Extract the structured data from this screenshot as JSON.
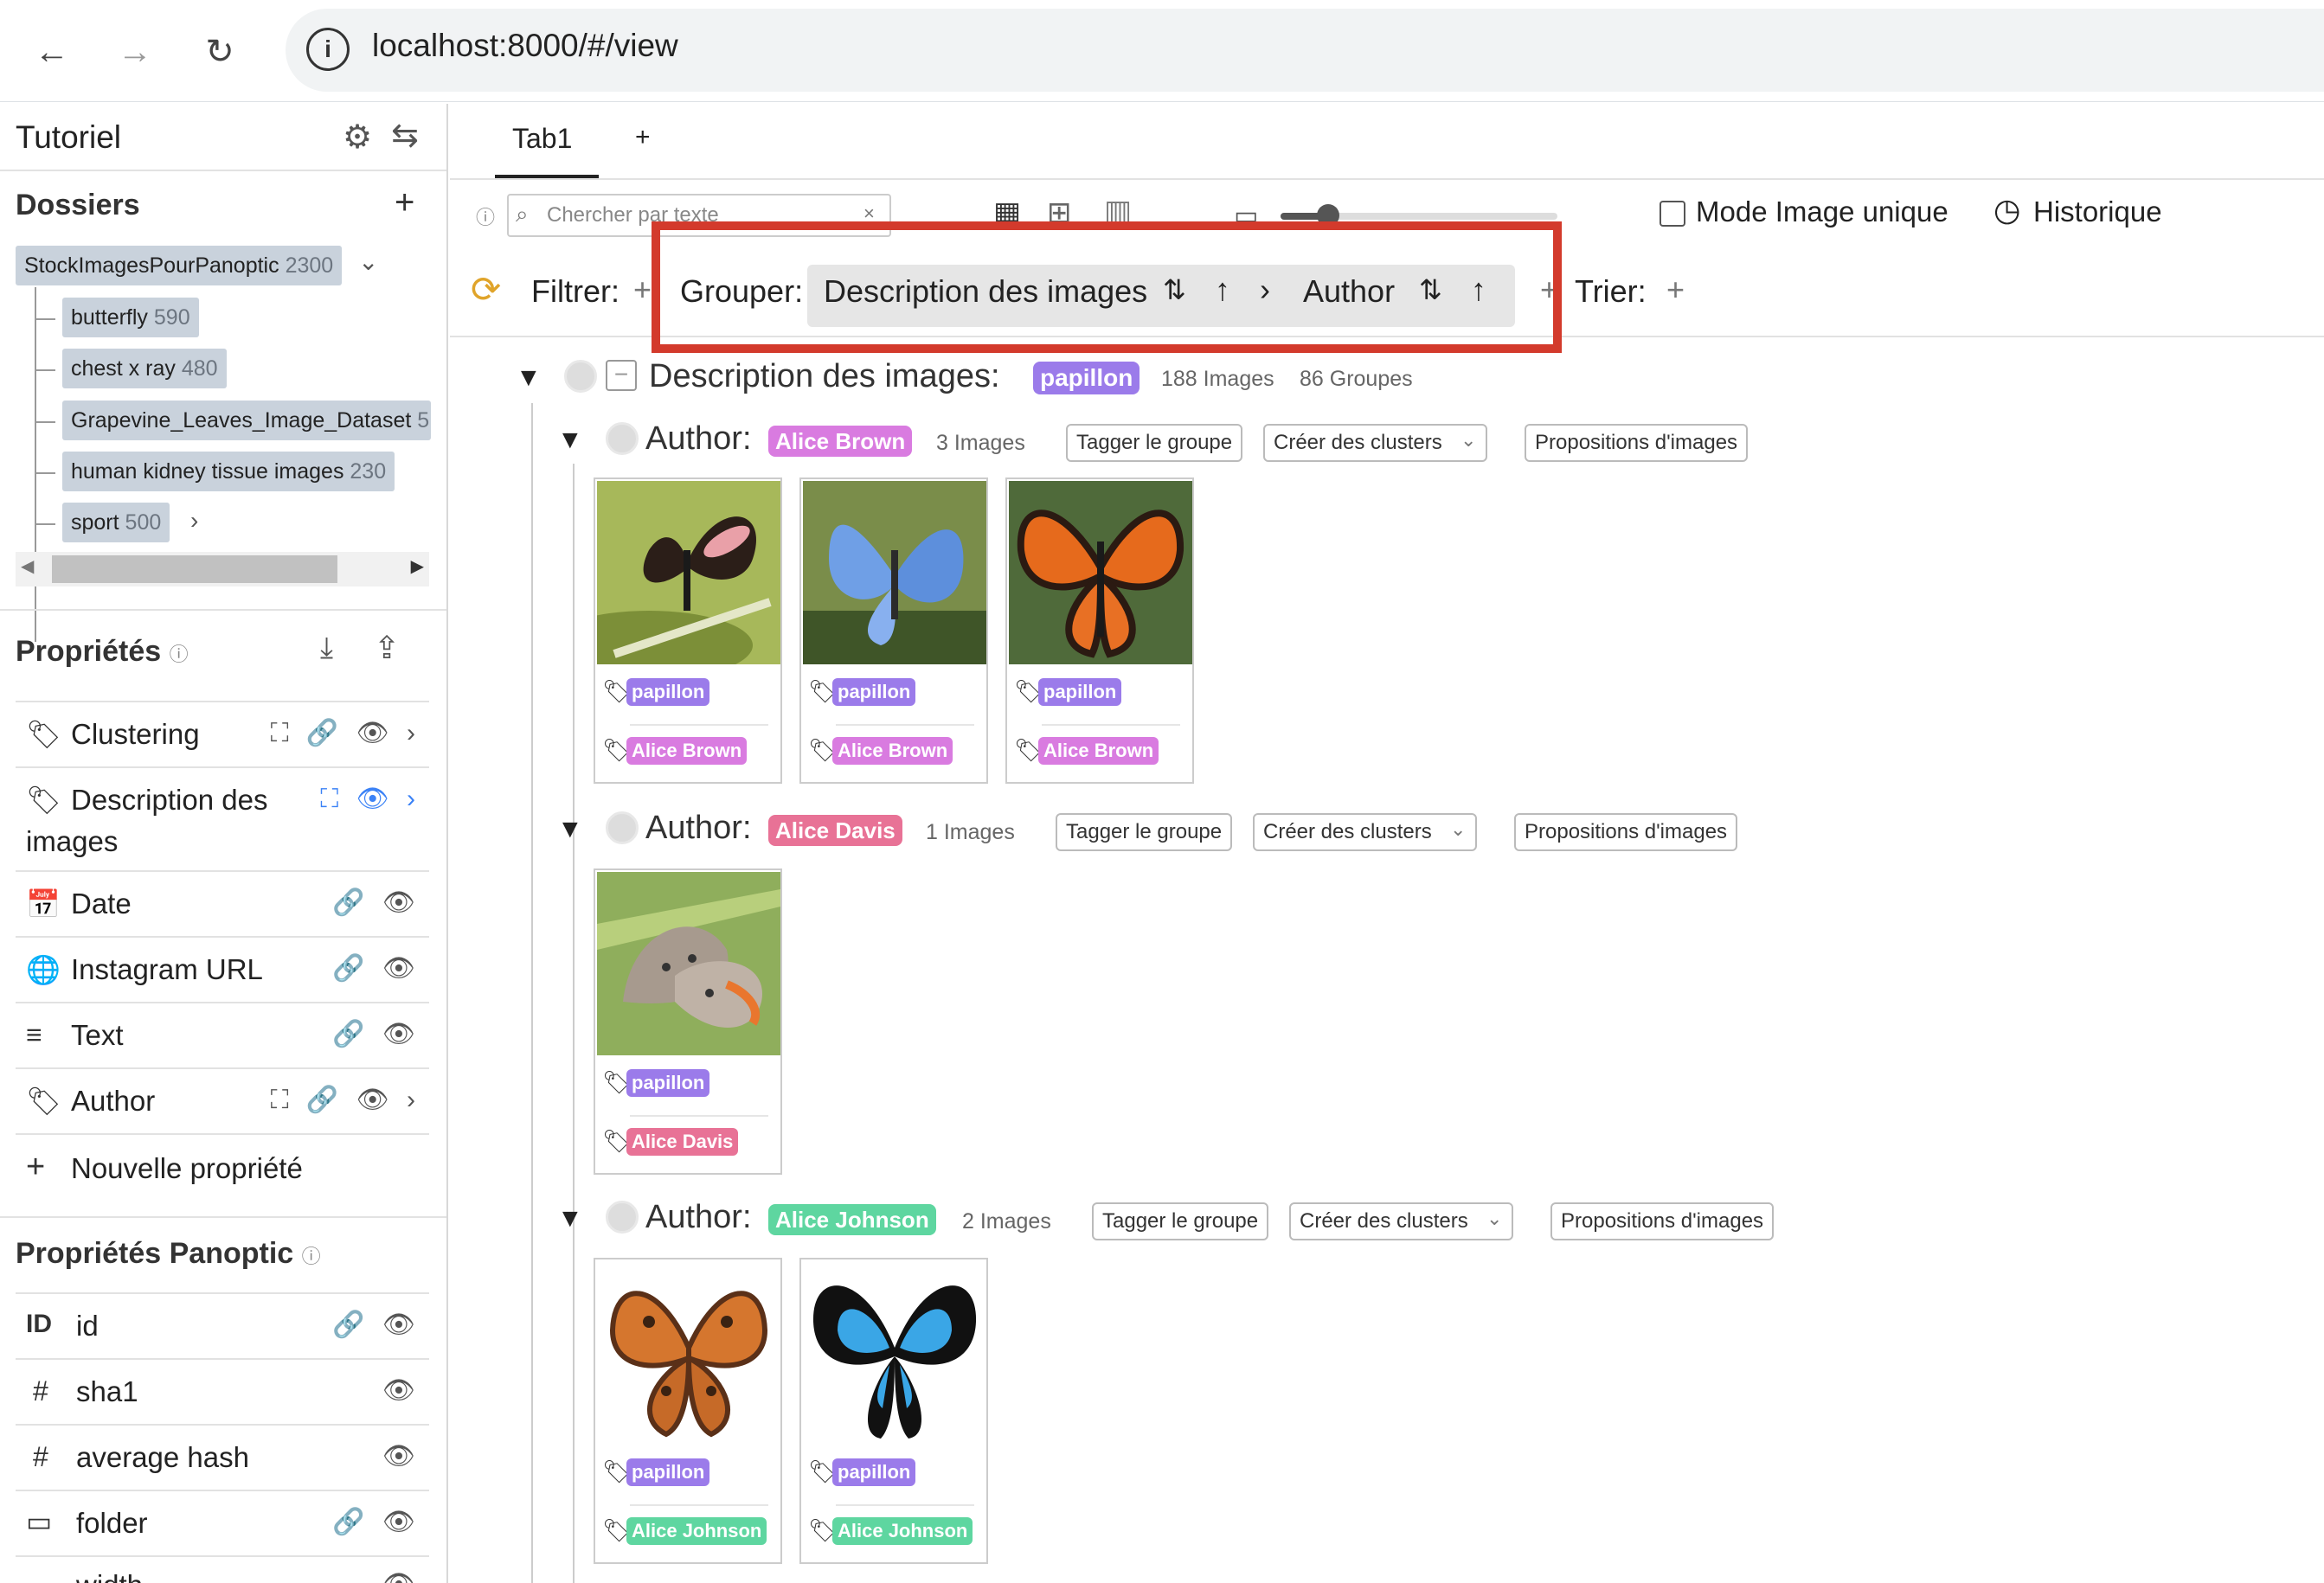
{
  "browser": {
    "back_icon": "←",
    "forward_icon": "→",
    "reload_icon": "↻",
    "info_icon": "i",
    "url": "localhost:8000/#/view"
  },
  "sidebar": {
    "project": "Tutoriel",
    "folders_title": "Dossiers",
    "add_folder": "+",
    "folders": [
      {
        "name": "StockImagesPourPanoptic",
        "count": "2300"
      },
      {
        "name": "butterfly",
        "count": "590"
      },
      {
        "name": "chest x ray",
        "count": "480"
      },
      {
        "name": "Grapevine_Leaves_Image_Dataset",
        "count": "5"
      },
      {
        "name": "human kidney tissue images",
        "count": "230"
      },
      {
        "name": "sport",
        "count": "500"
      }
    ],
    "properties_title": "Propriétés",
    "properties": [
      {
        "icon": "tag-icon",
        "label": "Clustering",
        "actions": "⛶ 🔗 👁 ›"
      },
      {
        "icon": "tag-icon",
        "label": "Description des",
        "label2": "images",
        "actions": "⛶  👁 ›"
      },
      {
        "icon": "calendar-icon",
        "label": "Date",
        "actions": "🔗 👁"
      },
      {
        "icon": "globe-icon",
        "label": "Instagram URL",
        "actions": "🔗 👁"
      },
      {
        "icon": "text-icon",
        "label": "Text",
        "actions": "🔗 👁"
      },
      {
        "icon": "tag-icon",
        "label": "Author",
        "actions": "⛶ 🔗 👁 ›"
      }
    ],
    "new_property": "Nouvelle propriété",
    "panoptic_title": "Propriétés Panoptic",
    "panoptic_properties": [
      {
        "icon": "ID",
        "label": "id",
        "actions": "🔗 👁"
      },
      {
        "icon": "#",
        "label": "sha1",
        "actions": "👁"
      },
      {
        "icon": "#",
        "label": "average hash",
        "actions": "👁"
      },
      {
        "icon": "▭",
        "label": "folder",
        "actions": "🔗 👁"
      },
      {
        "icon": "…",
        "label": "width",
        "actions": "👁"
      }
    ]
  },
  "main": {
    "tab": "Tab1",
    "add_tab": "+",
    "search_placeholder": "Chercher par texte",
    "single_image_mode": "Mode Image unique",
    "history": "Historique",
    "filter_label": "Filtrer:",
    "group_label": "Grouper:",
    "group_by_1": "Description des images",
    "group_by_2": "Author",
    "sort_label": "Trier:",
    "top_group": {
      "label": "Description des images:",
      "tag": "papillon",
      "images": "188 Images",
      "groups": "86 Groupes"
    },
    "subgroups": [
      {
        "label": "Author:",
        "tag": "Alice Brown",
        "count": "3 Images",
        "tag_btn": "Tagger le groupe",
        "cluster_btn": "Créer des clusters",
        "prop_btn": "Propositions d'images"
      },
      {
        "label": "Author:",
        "tag": "Alice Davis",
        "count": "1 Images",
        "tag_btn": "Tagger le groupe",
        "cluster_btn": "Créer des clusters",
        "prop_btn": "Propositions d'images"
      },
      {
        "label": "Author:",
        "tag": "Alice Johnson",
        "count": "2 Images",
        "tag_btn": "Tagger le groupe",
        "cluster_btn": "Créer des clusters",
        "prop_btn": "Propositions d'images"
      }
    ],
    "card_tag": "papillon"
  },
  "colors": {
    "papillon": "#9b7bea",
    "alice_brown": "#d97be0",
    "alice_davis": "#e87296",
    "alice_johnson": "#5ed6a0",
    "highlight": "#d33a2c"
  }
}
